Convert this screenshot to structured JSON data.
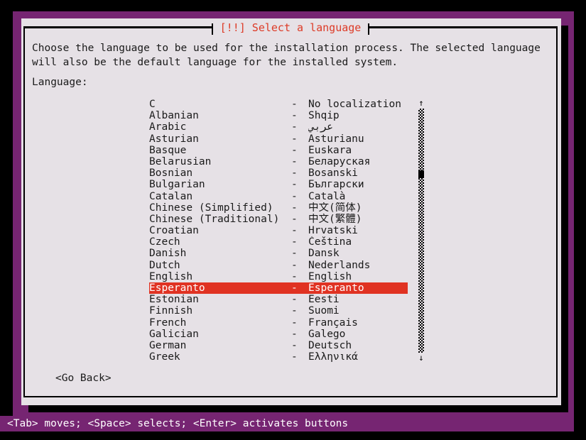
{
  "window": {
    "title": "[!!] Select a language",
    "backdrop_color": "#762572",
    "dialog_bg": "#e6e1e6",
    "title_color": "#dd3b27",
    "highlight_color": "#e03222"
  },
  "intro": {
    "text": "Choose the language to be used for the installation process. The selected language will also be the default language for the installed system."
  },
  "field": {
    "label": "Language:"
  },
  "list": {
    "separator": "-",
    "selected_index": 16,
    "items": [
      {
        "english": "C",
        "native": "No localization"
      },
      {
        "english": "Albanian",
        "native": "Shqip"
      },
      {
        "english": "Arabic",
        "native": "عربي"
      },
      {
        "english": "Asturian",
        "native": "Asturianu"
      },
      {
        "english": "Basque",
        "native": "Euskara"
      },
      {
        "english": "Belarusian",
        "native": "Беларуская"
      },
      {
        "english": "Bosnian",
        "native": "Bosanski"
      },
      {
        "english": "Bulgarian",
        "native": "Български"
      },
      {
        "english": "Catalan",
        "native": "Català"
      },
      {
        "english": "Chinese (Simplified)",
        "native": "中文(简体)"
      },
      {
        "english": "Chinese (Traditional)",
        "native": "中文(繁體)"
      },
      {
        "english": "Croatian",
        "native": "Hrvatski"
      },
      {
        "english": "Czech",
        "native": "Čeština"
      },
      {
        "english": "Danish",
        "native": "Dansk"
      },
      {
        "english": "Dutch",
        "native": "Nederlands"
      },
      {
        "english": "English",
        "native": "English"
      },
      {
        "english": "Esperanto",
        "native": "Esperanto"
      },
      {
        "english": "Estonian",
        "native": "Eesti"
      },
      {
        "english": "Finnish",
        "native": "Suomi"
      },
      {
        "english": "French",
        "native": "Français"
      },
      {
        "english": "Galician",
        "native": "Galego"
      },
      {
        "english": "German",
        "native": "Deutsch"
      },
      {
        "english": "Greek",
        "native": "Ελληνικά"
      }
    ]
  },
  "scrollbar": {
    "up_arrow": "↑",
    "down_arrow": "↓"
  },
  "buttons": {
    "go_back": "<Go Back>"
  },
  "statusbar": {
    "text": "<Tab> moves; <Space> selects; <Enter> activates buttons"
  }
}
